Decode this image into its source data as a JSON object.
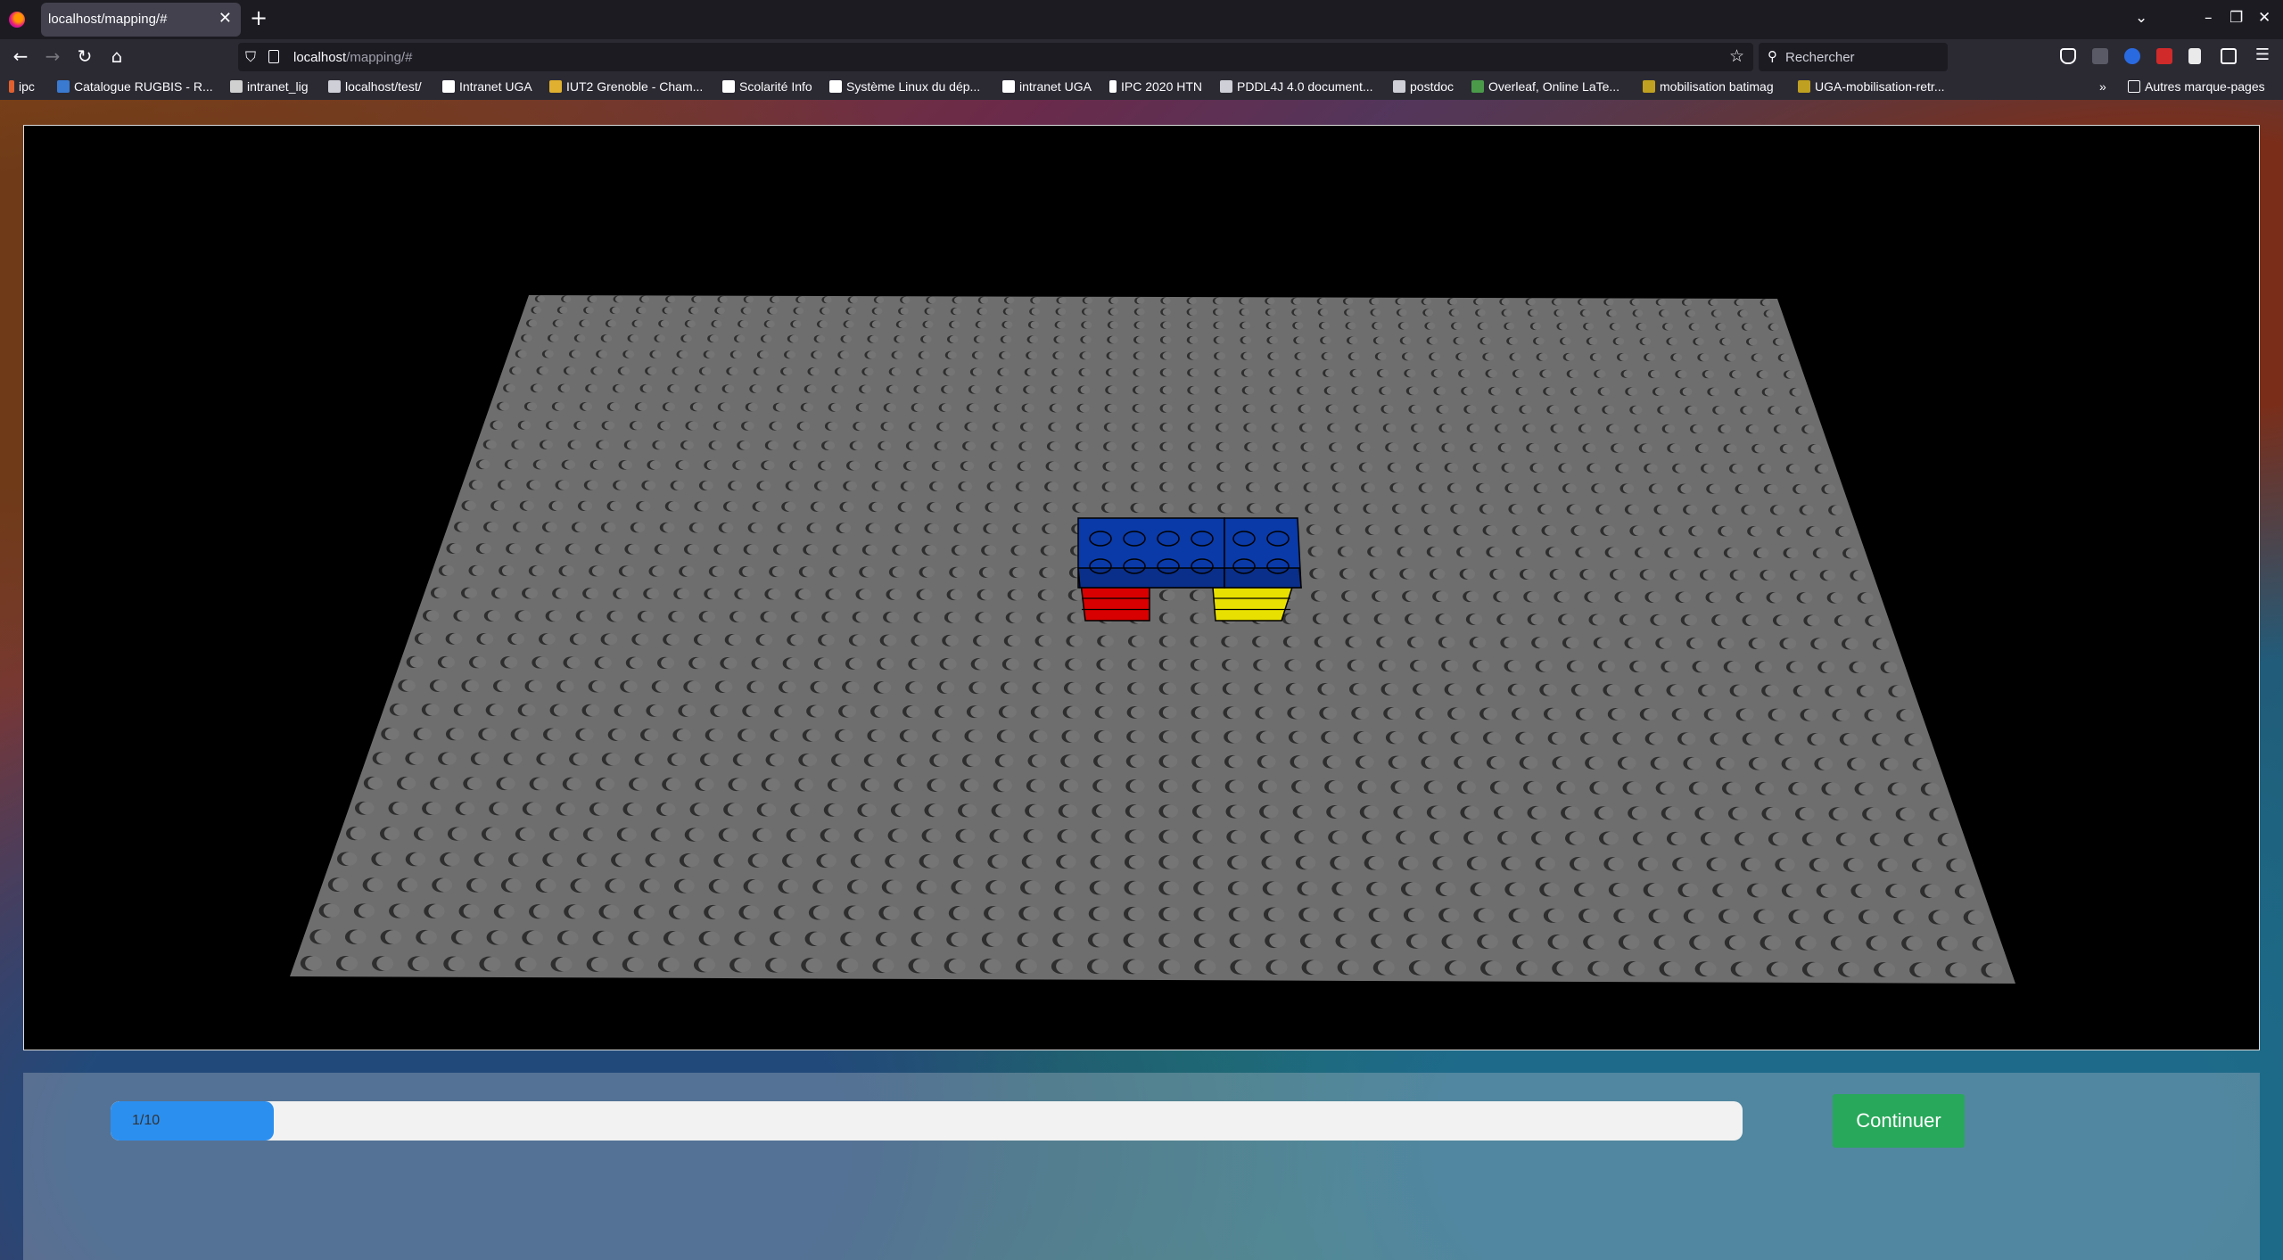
{
  "browser": {
    "tab_title": "localhost/mapping/#",
    "url_host": "localhost",
    "url_path": "/mapping/#",
    "search_placeholder": "Rechercher"
  },
  "bookmarks": [
    {
      "label": "ipc",
      "color": "#e06030"
    },
    {
      "label": "Catalogue RUGBIS - R...",
      "color": "#3a7ad0"
    },
    {
      "label": "intranet_lig",
      "color": "#d0d0d0"
    },
    {
      "label": "localhost/test/",
      "color": "#cfcfd8"
    },
    {
      "label": "Intranet UGA",
      "color": "#ffffff"
    },
    {
      "label": "IUT2 Grenoble - Cham...",
      "color": "#e0b030"
    },
    {
      "label": "Scolarité Info",
      "color": "#ffffff"
    },
    {
      "label": "Système Linux du dép...",
      "color": "#ffffff"
    },
    {
      "label": "intranet UGA",
      "color": "#ffffff"
    },
    {
      "label": "IPC 2020 HTN",
      "color": "#ffffff"
    },
    {
      "label": "PDDL4J 4.0 document...",
      "color": "#cfcfd8"
    },
    {
      "label": "postdoc",
      "color": "#cfcfd8"
    },
    {
      "label": "Overleaf, Online LaTe...",
      "color": "#4a9a4a"
    },
    {
      "label": "mobilisation batimag",
      "color": "#c0a020"
    },
    {
      "label": "UGA-mobilisation-retr...",
      "color": "#c0a020"
    }
  ],
  "other_bookmarks": "Autres marque-pages",
  "progress": {
    "text": "1/10",
    "value": 0.1
  },
  "continue_label": "Continuer",
  "colors": {
    "baseplate": "#6e6e6e",
    "brick_blue": "#0a3aa8",
    "brick_red": "#d80000",
    "brick_yellow": "#e8e000",
    "button_green": "#28a85a",
    "progress_blue": "#2b8ff0"
  }
}
